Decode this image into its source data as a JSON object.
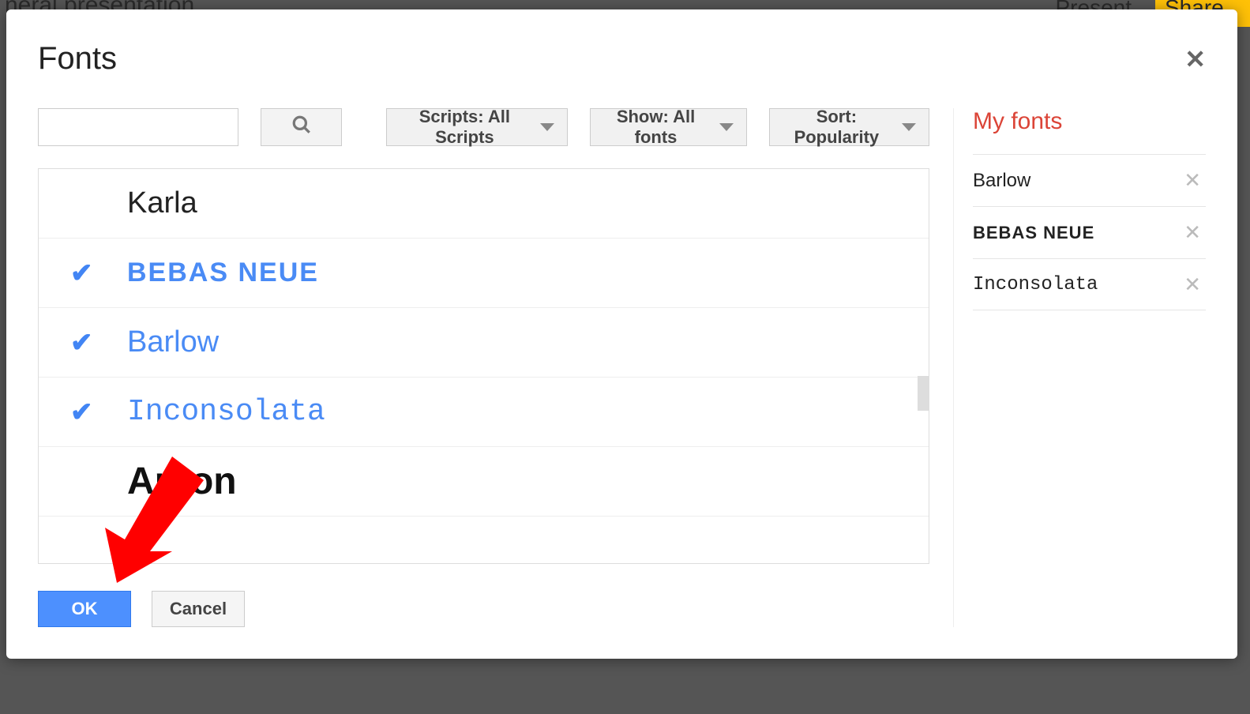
{
  "background": {
    "doc_title_fragment": "neral presentation",
    "present_label": "Present",
    "share_label": "Share"
  },
  "dialog": {
    "title": "Fonts",
    "filters": {
      "scripts": "Scripts: All Scripts",
      "show": "Show: All fonts",
      "sort": "Sort: Popularity"
    },
    "search_value": ""
  },
  "font_list": [
    {
      "name": "Karla",
      "selected": false,
      "style_class": "font-karla"
    },
    {
      "name": "Bebas Neue",
      "selected": true,
      "style_class": "font-bebas"
    },
    {
      "name": "Barlow",
      "selected": true,
      "style_class": "font-barlow"
    },
    {
      "name": "Inconsolata",
      "selected": true,
      "style_class": "font-inconsolata"
    },
    {
      "name": "Anton",
      "selected": false,
      "style_class": "font-anton"
    }
  ],
  "my_fonts": {
    "title": "My fonts",
    "items": [
      {
        "name": "Barlow",
        "style_class": "my-barlow"
      },
      {
        "name": "Bebas Neue",
        "style_class": "my-bebas"
      },
      {
        "name": "Inconsolata",
        "style_class": "my-inconsolata"
      }
    ]
  },
  "footer": {
    "ok": "OK",
    "cancel": "Cancel"
  },
  "annotation": {
    "arrow_target": "ok-button",
    "arrow_color": "#ff0000"
  }
}
